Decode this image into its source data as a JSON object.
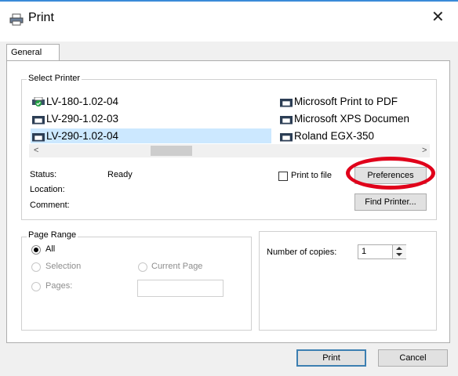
{
  "dialog": {
    "title": "Print",
    "close_glyph": "✕"
  },
  "tabs": [
    {
      "label": "General"
    }
  ],
  "select_printer": {
    "legend": "Select Printer",
    "printers": [
      {
        "name": "LV-180-1.02-04",
        "icon": "printer-default-icon"
      },
      {
        "name": "LV-290-1.02-03",
        "icon": "printer-icon"
      },
      {
        "name": "LV-290-1.02-04",
        "icon": "printer-icon",
        "selected": true
      },
      {
        "name": "Microsoft Print to PDF",
        "icon": "printer-icon"
      },
      {
        "name": "Microsoft XPS Documen",
        "icon": "printer-icon"
      },
      {
        "name": "Roland EGX-350",
        "icon": "printer-icon"
      }
    ],
    "scroll_left": "<",
    "scroll_right": ">",
    "status_label": "Status:",
    "status_value": "Ready",
    "location_label": "Location:",
    "comment_label": "Comment:",
    "print_to_file_label": "Print to file",
    "preferences_button": "Preferences",
    "find_printer_button": "Find Printer..."
  },
  "page_range": {
    "legend": "Page Range",
    "all_label": "All",
    "selection_label": "Selection",
    "current_page_label": "Current Page",
    "pages_label": "Pages:",
    "selected": "All"
  },
  "copies": {
    "label": "Number of copies:",
    "value": "1"
  },
  "footer": {
    "print_button": "Print",
    "cancel_button": "Cancel"
  },
  "colors": {
    "selection": "#cce8ff",
    "highlight_circle": "#e0001a",
    "default_button_border": "#3c7fb1"
  }
}
